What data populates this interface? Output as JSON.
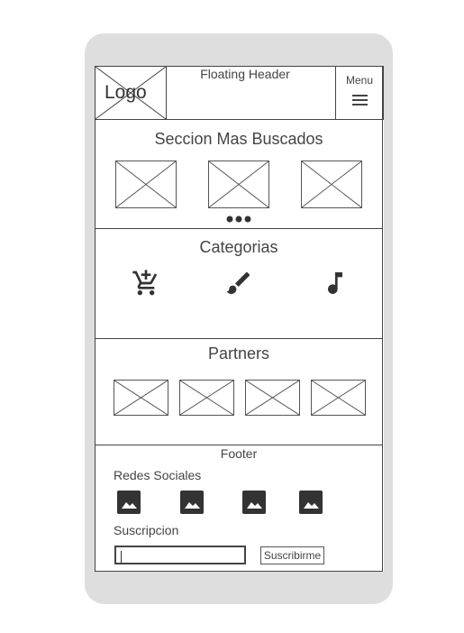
{
  "header": {
    "logo_label": "Logo",
    "title": "Floating Header",
    "menu_label": "Menu",
    "menu_icon": "hamburger-icon"
  },
  "mas_buscados": {
    "title": "Seccion Mas Buscados",
    "items": [
      "image-placeholder",
      "image-placeholder",
      "image-placeholder"
    ],
    "pager_icon": "more-dots-icon"
  },
  "categorias": {
    "title": "Categorias",
    "icons": [
      "cart-add-icon",
      "brush-icon",
      "music-note-icon"
    ]
  },
  "partners": {
    "title": "Partners",
    "items": [
      "image-placeholder",
      "image-placeholder",
      "image-placeholder",
      "image-placeholder"
    ]
  },
  "footer": {
    "title": "Footer",
    "redes_label": "Redes Sociales",
    "social_icons": [
      "image-icon",
      "image-icon",
      "image-icon",
      "image-icon"
    ],
    "suscripcion_label": "Suscripcion",
    "email_value": "",
    "subscribe_button": "Suscribirme"
  }
}
